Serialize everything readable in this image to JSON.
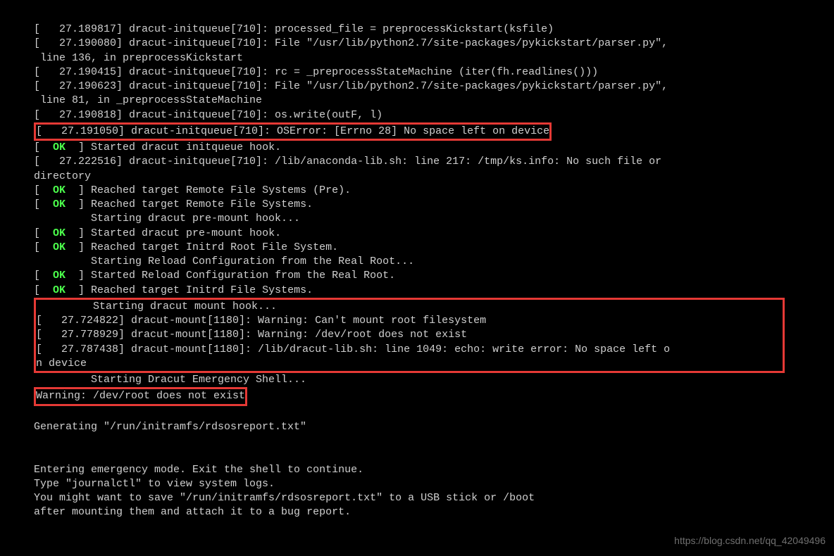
{
  "lines": {
    "l1": "[   27.189817] dracut-initqueue[710]: processed_file = preprocessKickstart(ksfile)",
    "l2": "[   27.190080] dracut-initqueue[710]: File \"/usr/lib/python2.7/site-packages/pykickstart/parser.py\",",
    "l3": " line 136, in preprocessKickstart",
    "l4": "[   27.190415] dracut-initqueue[710]: rc = _preprocessStateMachine (iter(fh.readlines()))",
    "l5": "[   27.190623] dracut-initqueue[710]: File \"/usr/lib/python2.7/site-packages/pykickstart/parser.py\",",
    "l6": " line 81, in _preprocessStateMachine",
    "l7": "[   27.190818] dracut-initqueue[710]: os.write(outF, l)",
    "hl1": "[   27.191050] dracut-initqueue[710]: OSError: [Errno 28] No space left on device",
    "l8a": "[  ",
    "l8b": "OK",
    "l8c": "  ] Started dracut initqueue hook.",
    "l9": "[   27.222516] dracut-initqueue[710]: /lib/anaconda-lib.sh: line 217: /tmp/ks.info: No such file or",
    "l10": "directory",
    "l11c": "  ] Reached target Remote File Systems (Pre).",
    "l12c": "  ] Reached target Remote File Systems.",
    "l13": "         Starting dracut pre-mount hook...",
    "l14c": "  ] Started dracut pre-mount hook.",
    "l15c": "  ] Reached target Initrd Root File System.",
    "l16": "         Starting Reload Configuration from the Real Root...",
    "l17c": "  ] Started Reload Configuration from the Real Root.",
    "l18c": "  ] Reached target Initrd File Systems.",
    "hl2": "         Starting dracut mount hook...\n[   27.724822] dracut-mount[1180]: Warning: Can't mount root filesystem\n[   27.778929] dracut-mount[1180]: Warning: /dev/root does not exist\n[   27.787438] dracut-mount[1180]: /lib/dracut-lib.sh: line 1049: echo: write error: No space left o\nn device",
    "l19": "         Starting Dracut Emergency Shell...",
    "hl3": "Warning: /dev/root does not exist",
    "blank": " ",
    "l20": "Generating \"/run/initramfs/rdsosreport.txt\"",
    "l21": "Entering emergency mode. Exit the shell to continue.",
    "l22": "Type \"journalctl\" to view system logs.",
    "l23": "You might want to save \"/run/initramfs/rdsosreport.txt\" to a USB stick or /boot",
    "l24": "after mounting them and attach it to a bug report."
  },
  "watermark": "https://blog.csdn.net/qq_42049496"
}
